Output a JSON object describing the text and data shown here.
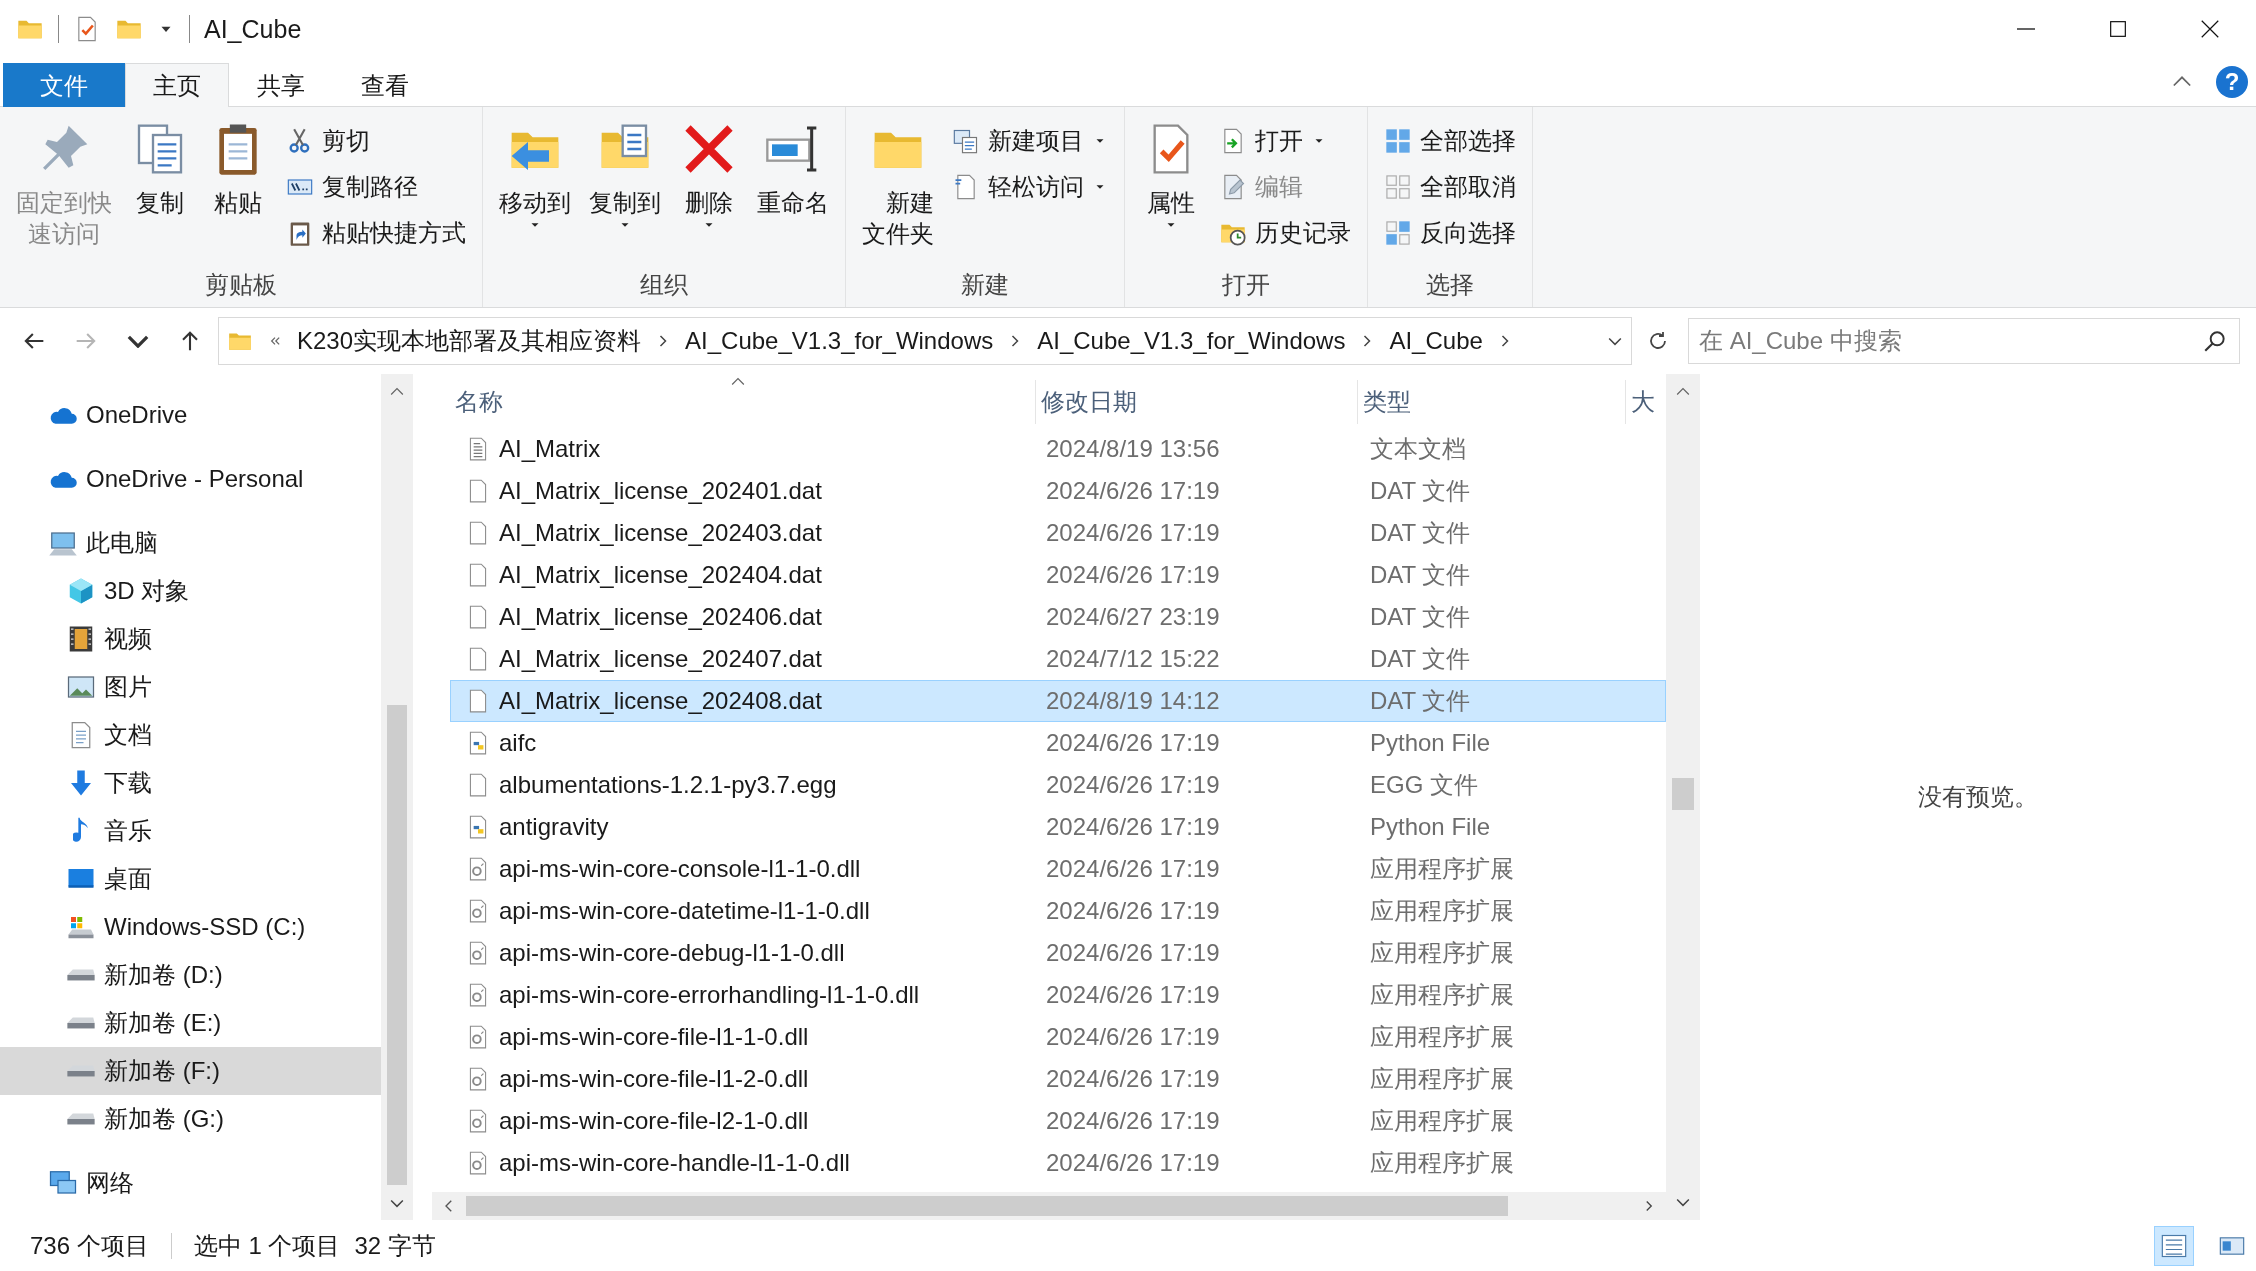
{
  "window": {
    "title": "AI_Cube",
    "help_button": "?"
  },
  "tabs": [
    {
      "label": "文件",
      "kind": "menu",
      "selected": false
    },
    {
      "label": "主页",
      "kind": "tab",
      "selected": true
    },
    {
      "label": "共享",
      "kind": "tab",
      "selected": false
    },
    {
      "label": "查看",
      "kind": "tab",
      "selected": false
    }
  ],
  "ribbon": {
    "groups": [
      {
        "label": "剪贴板",
        "items": [
          {
            "label": "固定到快速访问",
            "kind": "large",
            "disabled": true,
            "dropdown": false
          },
          {
            "label": "复制",
            "kind": "large",
            "disabled": false,
            "dropdown": false
          },
          {
            "label": "粘贴",
            "kind": "large",
            "disabled": false,
            "dropdown": false
          },
          {
            "label": "剪切",
            "kind": "small",
            "disabled": false,
            "dropdown": false
          },
          {
            "label": "复制路径",
            "kind": "small",
            "disabled": false,
            "dropdown": false
          },
          {
            "label": "粘贴快捷方式",
            "kind": "small",
            "disabled": false,
            "dropdown": false
          }
        ]
      },
      {
        "label": "组织",
        "items": [
          {
            "label": "移动到",
            "kind": "large",
            "disabled": false,
            "dropdown": true
          },
          {
            "label": "复制到",
            "kind": "large",
            "disabled": false,
            "dropdown": true
          },
          {
            "label": "删除",
            "kind": "large",
            "disabled": false,
            "dropdown": true
          },
          {
            "label": "重命名",
            "kind": "large",
            "disabled": false,
            "dropdown": false
          }
        ]
      },
      {
        "label": "新建",
        "items": [
          {
            "label": "新建文件夹",
            "kind": "large",
            "disabled": false,
            "dropdown": false
          },
          {
            "label": "新建项目",
            "kind": "small",
            "disabled": false,
            "dropdown": true
          },
          {
            "label": "轻松访问",
            "kind": "small",
            "disabled": false,
            "dropdown": true
          }
        ]
      },
      {
        "label": "打开",
        "items": [
          {
            "label": "属性",
            "kind": "large",
            "disabled": false,
            "dropdown": true
          },
          {
            "label": "打开",
            "kind": "small",
            "disabled": false,
            "dropdown": true
          },
          {
            "label": "编辑",
            "kind": "small",
            "disabled": true,
            "dropdown": false
          },
          {
            "label": "历史记录",
            "kind": "small",
            "disabled": false,
            "dropdown": false
          }
        ]
      },
      {
        "label": "选择",
        "items": [
          {
            "label": "全部选择",
            "kind": "small",
            "disabled": false,
            "dropdown": false
          },
          {
            "label": "全部取消",
            "kind": "small",
            "disabled": false,
            "dropdown": false
          },
          {
            "label": "反向选择",
            "kind": "small",
            "disabled": false,
            "dropdown": false
          }
        ]
      }
    ]
  },
  "nav_buttons": [
    {
      "kind": "back",
      "disabled": false
    },
    {
      "kind": "forward",
      "disabled": true
    },
    {
      "kind": "recent",
      "disabled": false
    },
    {
      "kind": "up",
      "disabled": false
    }
  ],
  "address": {
    "crumbs": [
      "K230实现本地部署及其相应资料",
      "AI_Cube_V1.3_for_Windows",
      "AI_Cube_V1.3_for_Windows",
      "AI_Cube"
    ]
  },
  "search": {
    "placeholder": "在 AI_Cube 中搜索"
  },
  "sidebar": {
    "items": [
      {
        "label": "OneDrive",
        "kind": "cloud",
        "selected": false
      },
      {
        "label": "OneDrive - Personal",
        "kind": "cloud",
        "selected": false
      },
      {
        "label": "此电脑",
        "kind": "computer",
        "selected": false,
        "children": [
          {
            "label": "3D 对象",
            "kind": "cube",
            "selected": false
          },
          {
            "label": "视频",
            "kind": "video",
            "selected": false
          },
          {
            "label": "图片",
            "kind": "picture",
            "selected": false
          },
          {
            "label": "文档",
            "kind": "document",
            "selected": false
          },
          {
            "label": "下载",
            "kind": "download",
            "selected": false
          },
          {
            "label": "音乐",
            "kind": "music",
            "selected": false
          },
          {
            "label": "桌面",
            "kind": "desktop",
            "selected": false
          },
          {
            "label": "Windows-SSD (C:)",
            "kind": "system-drive",
            "selected": false
          },
          {
            "label": "新加卷 (D:)",
            "kind": "drive",
            "selected": false
          },
          {
            "label": "新加卷 (E:)",
            "kind": "drive",
            "selected": false
          },
          {
            "label": "新加卷 (F:)",
            "kind": "drive",
            "selected": true
          },
          {
            "label": "新加卷 (G:)",
            "kind": "drive",
            "selected": false
          }
        ]
      },
      {
        "label": "网络",
        "kind": "network",
        "selected": false
      }
    ]
  },
  "file_list": {
    "columns": [
      "名称",
      "修改日期",
      "类型",
      "大"
    ],
    "rows": [
      {
        "name": "AI_Matrix",
        "modified": "2024/8/19 13:56",
        "type": "文本文档",
        "kind": "text",
        "selected": false
      },
      {
        "name": "AI_Matrix_license_202401.dat",
        "modified": "2024/6/26 17:19",
        "type": "DAT 文件",
        "kind": "blank",
        "selected": false
      },
      {
        "name": "AI_Matrix_license_202403.dat",
        "modified": "2024/6/26 17:19",
        "type": "DAT 文件",
        "kind": "blank",
        "selected": false
      },
      {
        "name": "AI_Matrix_license_202404.dat",
        "modified": "2024/6/26 17:19",
        "type": "DAT 文件",
        "kind": "blank",
        "selected": false
      },
      {
        "name": "AI_Matrix_license_202406.dat",
        "modified": "2024/6/27 23:19",
        "type": "DAT 文件",
        "kind": "blank",
        "selected": false
      },
      {
        "name": "AI_Matrix_license_202407.dat",
        "modified": "2024/7/12 15:22",
        "type": "DAT 文件",
        "kind": "blank",
        "selected": false
      },
      {
        "name": "AI_Matrix_license_202408.dat",
        "modified": "2024/8/19 14:12",
        "type": "DAT 文件",
        "kind": "blank",
        "selected": true
      },
      {
        "name": "aifc",
        "modified": "2024/6/26 17:19",
        "type": "Python File",
        "kind": "python",
        "selected": false
      },
      {
        "name": "albumentations-1.2.1-py3.7.egg",
        "modified": "2024/6/26 17:19",
        "type": "EGG 文件",
        "kind": "blank",
        "selected": false
      },
      {
        "name": "antigravity",
        "modified": "2024/6/26 17:19",
        "type": "Python File",
        "kind": "python",
        "selected": false
      },
      {
        "name": "api-ms-win-core-console-l1-1-0.dll",
        "modified": "2024/6/26 17:19",
        "type": "应用程序扩展",
        "kind": "library",
        "selected": false
      },
      {
        "name": "api-ms-win-core-datetime-l1-1-0.dll",
        "modified": "2024/6/26 17:19",
        "type": "应用程序扩展",
        "kind": "library",
        "selected": false
      },
      {
        "name": "api-ms-win-core-debug-l1-1-0.dll",
        "modified": "2024/6/26 17:19",
        "type": "应用程序扩展",
        "kind": "library",
        "selected": false
      },
      {
        "name": "api-ms-win-core-errorhandling-l1-1-0.dll",
        "modified": "2024/6/26 17:19",
        "type": "应用程序扩展",
        "kind": "library",
        "selected": false
      },
      {
        "name": "api-ms-win-core-file-l1-1-0.dll",
        "modified": "2024/6/26 17:19",
        "type": "应用程序扩展",
        "kind": "library",
        "selected": false
      },
      {
        "name": "api-ms-win-core-file-l1-2-0.dll",
        "modified": "2024/6/26 17:19",
        "type": "应用程序扩展",
        "kind": "library",
        "selected": false
      },
      {
        "name": "api-ms-win-core-file-l2-1-0.dll",
        "modified": "2024/6/26 17:19",
        "type": "应用程序扩展",
        "kind": "library",
        "selected": false
      },
      {
        "name": "api-ms-win-core-handle-l1-1-0.dll",
        "modified": "2024/6/26 17:19",
        "type": "应用程序扩展",
        "kind": "library",
        "selected": false
      }
    ]
  },
  "preview": {
    "message": "没有预览。"
  },
  "status_bar": {
    "texts": [
      "736 个项目",
      "选中 1 个项目",
      "32 字节"
    ],
    "views": [
      {
        "kind": "details",
        "selected": true
      },
      {
        "kind": "tiles",
        "selected": false
      }
    ]
  }
}
